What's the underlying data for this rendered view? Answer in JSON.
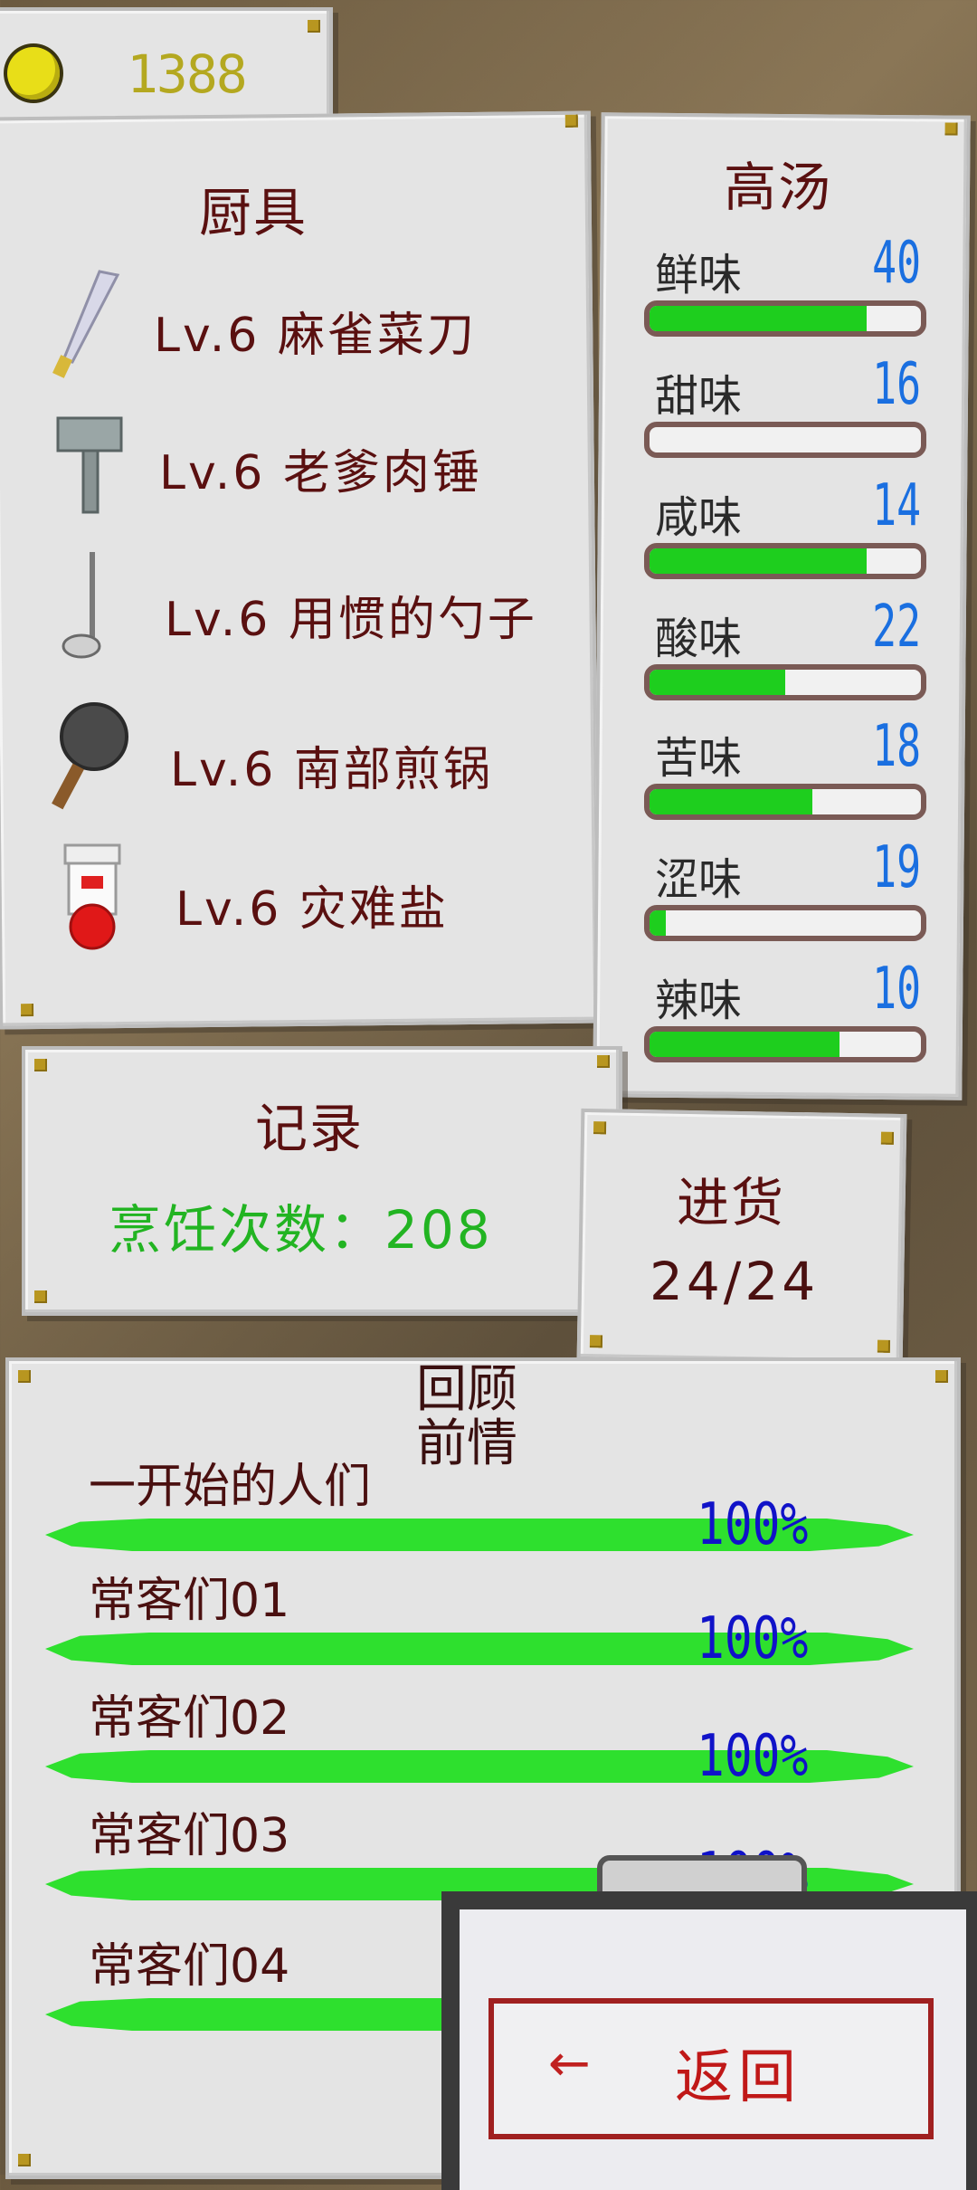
{
  "currency": {
    "icon": "gold-coin-icon",
    "value": "1388"
  },
  "tools": {
    "title": "厨具",
    "items": [
      {
        "label": "Lv.6 麻雀菜刀",
        "icon": "knife-icon"
      },
      {
        "label": "Lv.6 老爹肉锤",
        "icon": "meat-hammer-icon"
      },
      {
        "label": "Lv.6 用惯的勺子",
        "icon": "ladle-icon"
      },
      {
        "label": "Lv.6 南部煎锅",
        "icon": "frying-pan-icon"
      },
      {
        "label": "Lv.6 灾难盐",
        "icon": "salt-shaker-icon"
      }
    ]
  },
  "soup": {
    "title": "高汤",
    "flavors": [
      {
        "name": "鲜味",
        "value": "40",
        "fill": 0.8
      },
      {
        "name": "甜味",
        "value": "16",
        "fill": 0.0
      },
      {
        "name": "咸味",
        "value": "14",
        "fill": 0.8
      },
      {
        "name": "酸味",
        "value": "22",
        "fill": 0.5
      },
      {
        "name": "苦味",
        "value": "18",
        "fill": 0.6
      },
      {
        "name": "涩味",
        "value": "19",
        "fill": 0.06
      },
      {
        "name": "辣味",
        "value": "10",
        "fill": 0.7
      }
    ]
  },
  "record": {
    "title": "记录",
    "cook_count": "烹饪次数：208"
  },
  "restock": {
    "title": "进货",
    "value": "24/24"
  },
  "review": {
    "title_line1": "回顾",
    "title_line2": "前情",
    "stories": [
      {
        "name": "一开始的人们",
        "percent": "100%"
      },
      {
        "name": "常客们01",
        "percent": "100%"
      },
      {
        "name": "常客们02",
        "percent": "100%"
      },
      {
        "name": "常客们03",
        "percent": "100%"
      },
      {
        "name": "常客们04",
        "percent": ""
      }
    ]
  },
  "back_button": {
    "label": "返回",
    "arrow": "←"
  },
  "colors": {
    "panel": "#e4e4e4",
    "title": "#5a1010",
    "bar_green": "#1ece1e",
    "flavor_value": "#1a6fe0",
    "percent": "#1012c8",
    "back_red": "#a02020"
  }
}
